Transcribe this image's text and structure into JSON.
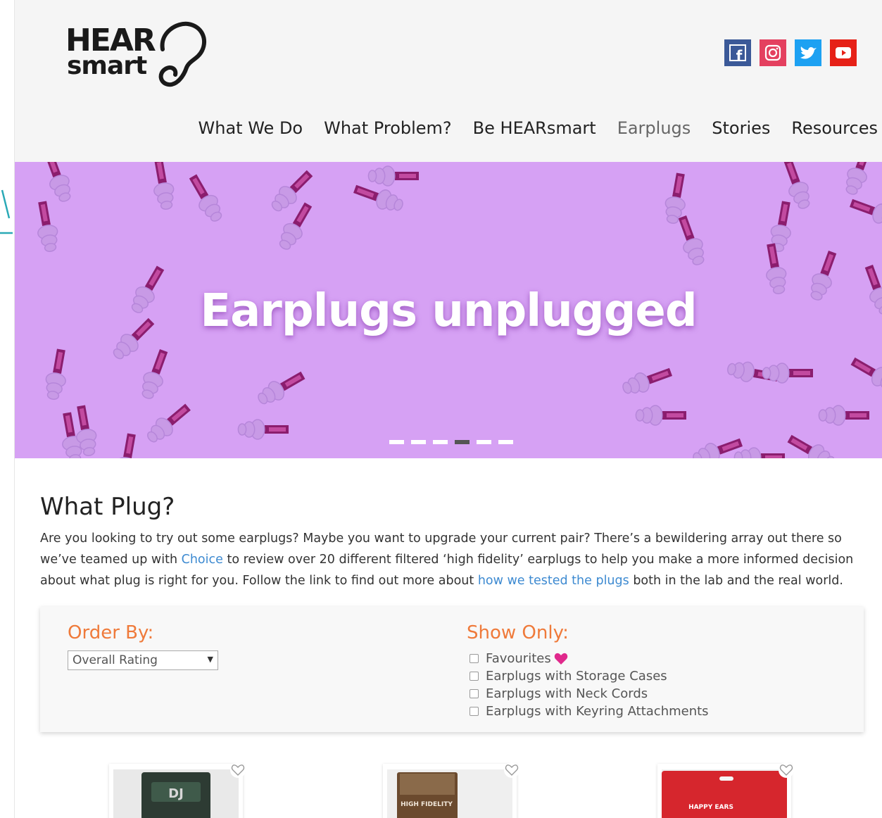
{
  "brand": {
    "line1": "HEAR",
    "line2": "smart"
  },
  "social": [
    {
      "name": "facebook-icon",
      "glyph": "f",
      "color": "#3b5998"
    },
    {
      "name": "instagram-icon",
      "glyph": "◎",
      "color": "#e4405f"
    },
    {
      "name": "twitter-icon",
      "glyph": "t",
      "color": "#1da1f2"
    },
    {
      "name": "youtube-icon",
      "glyph": "▶",
      "color": "#e62117"
    }
  ],
  "nav": [
    "What We Do",
    "What Problem?",
    "Be HEARsmart",
    "Earplugs",
    "Stories",
    "Resources"
  ],
  "hero": {
    "title": "Earplugs unplugged",
    "slides": 6,
    "active_slide": 4
  },
  "section": {
    "title": "What Plug?",
    "intro_1": "Are you looking to try out some earplugs? Maybe you want to upgrade your current pair? There’s a bewildering array out there so we’ve teamed up with ",
    "link_choice": "Choice",
    "intro_2": " to review over 20 different filtered ‘high fidelity’ earplugs to help you make a more informed decision about what plug is right for you. Follow the link to find out more about ",
    "link_tested": "how we tested the plugs",
    "intro_3": " both in the lab and the real world."
  },
  "filters": {
    "order_by_label": "Order By:",
    "order_by_value": "Overall Rating",
    "show_only_label": "Show Only:",
    "options": [
      "Favourites",
      "Earplugs with Storage Cases",
      "Earplugs with Neck Cords",
      "Earplugs with Keyring Attachments"
    ]
  },
  "products": [
    {
      "label": "DJ",
      "color": "#2d3b33"
    },
    {
      "label": "HIGH FIDELITY",
      "color": "#6b4a2e"
    },
    {
      "label": "HAPPY EARS",
      "color": "#d6262d"
    }
  ],
  "colors": {
    "hero_bg": "#d6a1f4",
    "accent_orange": "#ef7a3a",
    "link_blue": "#3d8ad1",
    "heart_pink": "#e0298c"
  }
}
